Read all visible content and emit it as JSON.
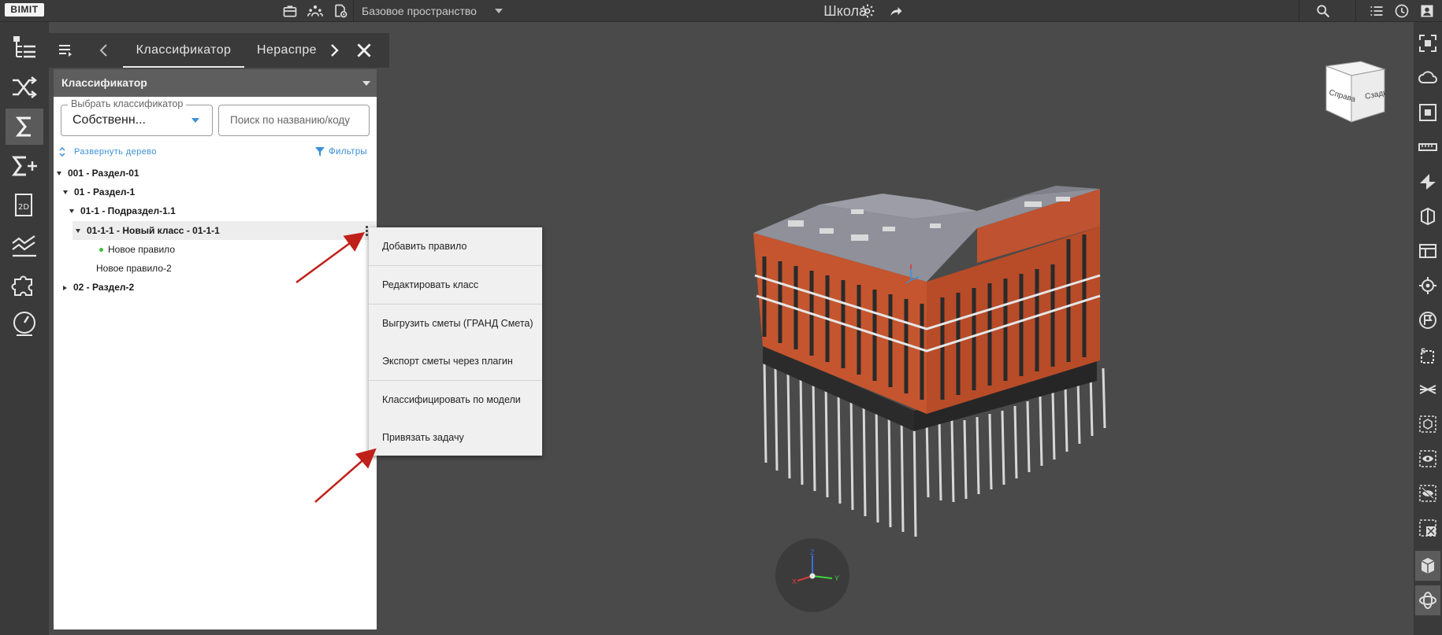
{
  "app": {
    "logo": "BIMIT",
    "project_title": "Школа"
  },
  "topbar": {
    "space_selector": "Базовое пространство",
    "icons": [
      "briefcase-icon",
      "team-icon",
      "settings-doc-icon",
      "gear-icon",
      "share-icon",
      "search-icon",
      "list-icon",
      "sync-icon",
      "user-icon"
    ]
  },
  "leftbar": {
    "items": [
      "tree-icon",
      "shuffle-icon",
      "sigma-icon",
      "sigma-plus-icon",
      "2d-doc-icon",
      "chart-icon",
      "puzzle-icon",
      "gauge-icon"
    ],
    "active": "sigma-icon",
    "help_label": "?"
  },
  "panel": {
    "tabs": [
      "Классификатор",
      "Нераспре"
    ],
    "active_tab": "Классификатор",
    "header": "Классификатор",
    "classifier_select": {
      "legend": "Выбрать классификатор",
      "value": "Собственн..."
    },
    "search_placeholder": "Поиск по названию/коду",
    "expand_label": "Развернуть дерево",
    "filters_label": "Фильтры",
    "tree": [
      {
        "label": "001 - Раздел-01"
      },
      {
        "label": "01 - Раздел-1"
      },
      {
        "label": "01-1 - Подраздел-1.1"
      },
      {
        "label": "01-1-1 - Новый класс - 01-1-1"
      },
      {
        "label": "Новое правило"
      },
      {
        "label": "Новое правило-2"
      },
      {
        "label": "02 - Раздел-2"
      }
    ]
  },
  "context_menu": {
    "items": [
      "Добавить правило",
      "Редактировать класс",
      "Выгрузить сметы (ГРАНД Смета)",
      "Экспорт сметы через плагин",
      "Классифицировать по модели",
      "Привязать задачу"
    ]
  },
  "viewport": {
    "viewcube_faces": [
      "Справа",
      "Сзади"
    ],
    "axis_labels": [
      "Z",
      "X",
      "Y"
    ]
  },
  "rightbar": {
    "items": [
      "fit-view-icon",
      "cloud-icon",
      "focus-icon",
      "ruler-icon",
      "section-icon",
      "box-section-icon",
      "plan-icon",
      "locate-icon",
      "flag-icon",
      "measure-icon",
      "hide-lines-icon",
      "cube-outline-icon",
      "eye-icon",
      "eye-off-icon",
      "hide-box-icon",
      "solid-cube-icon",
      "orbit-icon"
    ]
  },
  "colors": {
    "accent": "#3b8fd6",
    "facade": "#c4552e",
    "toolbar": "#3a3a3a",
    "background": "#4a4a4a"
  }
}
